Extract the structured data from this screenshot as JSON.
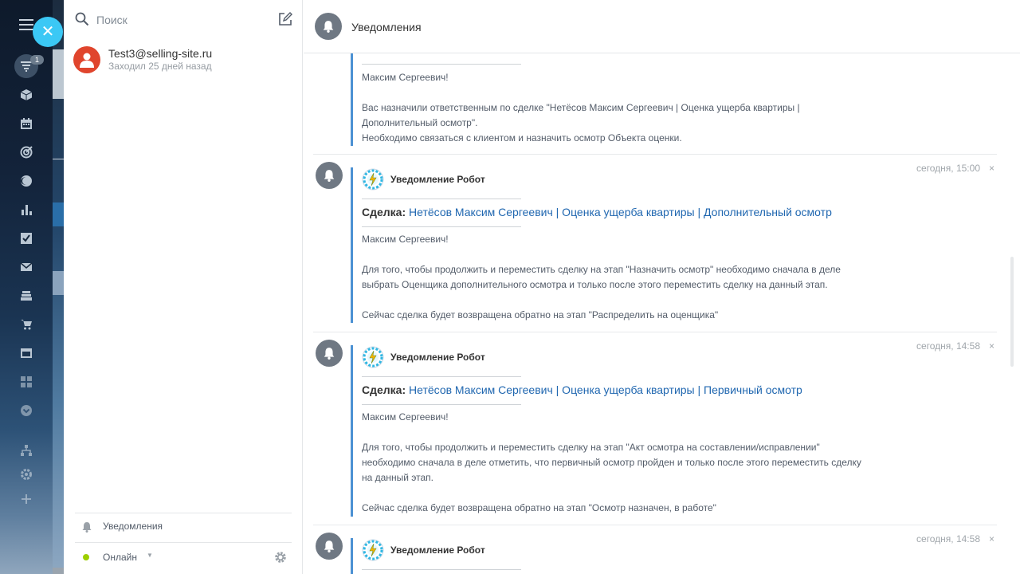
{
  "search": {
    "placeholder": "Поиск"
  },
  "contacts": [
    {
      "name": "Test3@selling-site.ru",
      "status": "Заходил 25 дней назад"
    }
  ],
  "sidebar_bottom": {
    "notifications_label": "Уведомления",
    "status_label": "Онлайн"
  },
  "rail": {
    "badge": "1",
    "icons": [
      "filter-icon",
      "box-icon",
      "calendar-icon",
      "target-icon",
      "clock-icon",
      "bar-chart-icon",
      "checkbox-icon",
      "mail-icon",
      "stack-icon",
      "cart-icon",
      "window-icon",
      "grid-icon",
      "chevron-down-icon",
      "sitemap-icon",
      "gear-icon",
      "plus-icon"
    ]
  },
  "header": {
    "title": "Уведомления"
  },
  "colors": {
    "accent": "#3bc8f5",
    "link": "#2067b0",
    "bar": "#4c91d3",
    "online": "#9dcf00",
    "avatar": "#e0452d"
  },
  "notifications": [
    {
      "paragraphs": [
        [
          "Максим Сергеевич!"
        ],
        [
          "Вас назначили ответственным по сделке \"Нетёсов Максим Сергеевич | Оценка ущерба квартиры |",
          "Дополнительный осмотр\".",
          "Необходимо связаться с клиентом и назначить осмотр Объекта оценки."
        ]
      ]
    },
    {
      "sender": "Уведомление Робот",
      "time": "сегодня, 15:00",
      "close": "×",
      "deal_label": "Сделка:",
      "deal_link": "Нетёсов Максим Сергеевич | Оценка ущерба квартиры | Дополнительный осмотр",
      "paragraphs": [
        [
          "Максим Сергеевич!"
        ],
        [
          "Для того, чтобы продолжить и переместить сделку на этап \"Назначить осмотр\" необходимо сначала в деле",
          "выбрать Оценщика дополнительного осмотра и только после этого переместить сделку на данный этап."
        ],
        [
          "Сейчас сделка будет возвращена обратно на этап \"Распределить на оценщика\""
        ]
      ]
    },
    {
      "sender": "Уведомление Робот",
      "time": "сегодня, 14:58",
      "close": "×",
      "deal_label": "Сделка:",
      "deal_link": "Нетёсов Максим Сергеевич | Оценка ущерба квартиры | Первичный осмотр",
      "paragraphs": [
        [
          "Максим Сергеевич!"
        ],
        [
          "Для того, чтобы продолжить и переместить сделку на этап \"Акт осмотра на составлении/исправлении\"",
          "необходимо сначала в деле отметить, что первичный осмотр пройден и только после этого переместить сделку",
          "на данный этап."
        ],
        [
          "Сейчас сделка будет возвращена обратно на этап \"Осмотр назначен, в работе\""
        ]
      ]
    },
    {
      "sender": "Уведомление Робот",
      "time": "сегодня, 14:58",
      "close": "×"
    }
  ]
}
